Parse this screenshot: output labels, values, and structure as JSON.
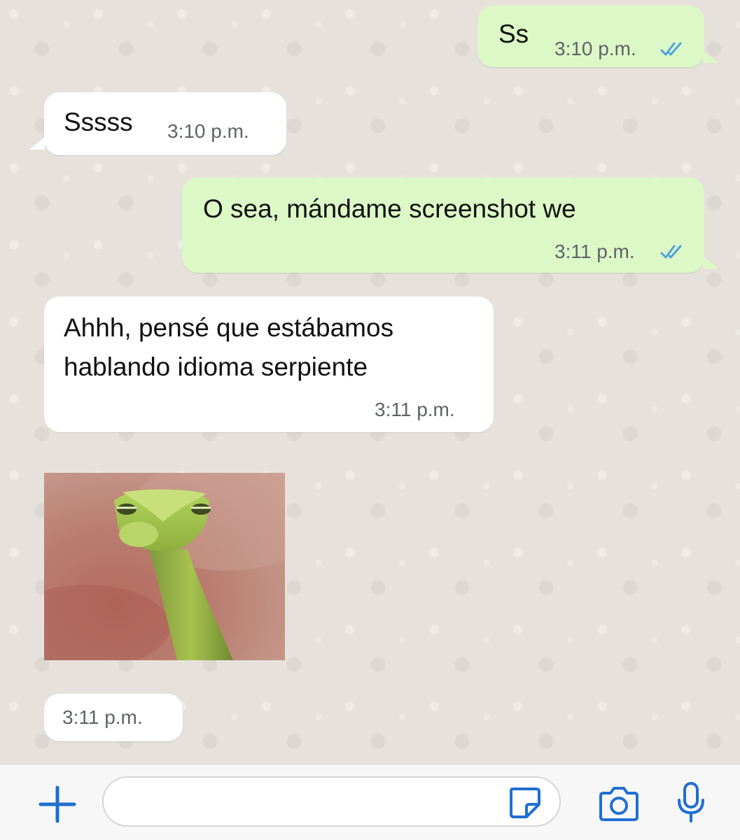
{
  "messages": [
    {
      "direction": "outgoing",
      "text": "Ss",
      "time": "3:10 p.m.",
      "status": "read-double-check"
    },
    {
      "direction": "incoming",
      "text": "Sssss",
      "time": "3:10 p.m."
    },
    {
      "direction": "outgoing",
      "text": "O sea, mándame screenshot we",
      "time": "3:11 p.m.",
      "status": "read-double-check"
    },
    {
      "direction": "incoming",
      "lines": [
        "Ahhh, pensé que estábamos",
        "hablando idioma serpiente"
      ],
      "time": "3:11 p.m."
    },
    {
      "direction": "incoming",
      "type": "image",
      "image_subject": "green vine snake head photo"
    },
    {
      "direction": "incoming",
      "time": "3:11 p.m."
    }
  ],
  "input_bar": {
    "add_icon": "plus-icon",
    "message_placeholder": "",
    "sticker_icon": "sticker-icon",
    "camera_icon": "camera-icon",
    "mic_icon": "microphone-icon"
  },
  "colors": {
    "outgoing_bubble": "#dcf8c6",
    "incoming_bubble": "#ffffff",
    "read_ticks": "#4fa3e0",
    "icon_blue": "#1f6fd1",
    "wallpaper": "#e6e2db"
  }
}
